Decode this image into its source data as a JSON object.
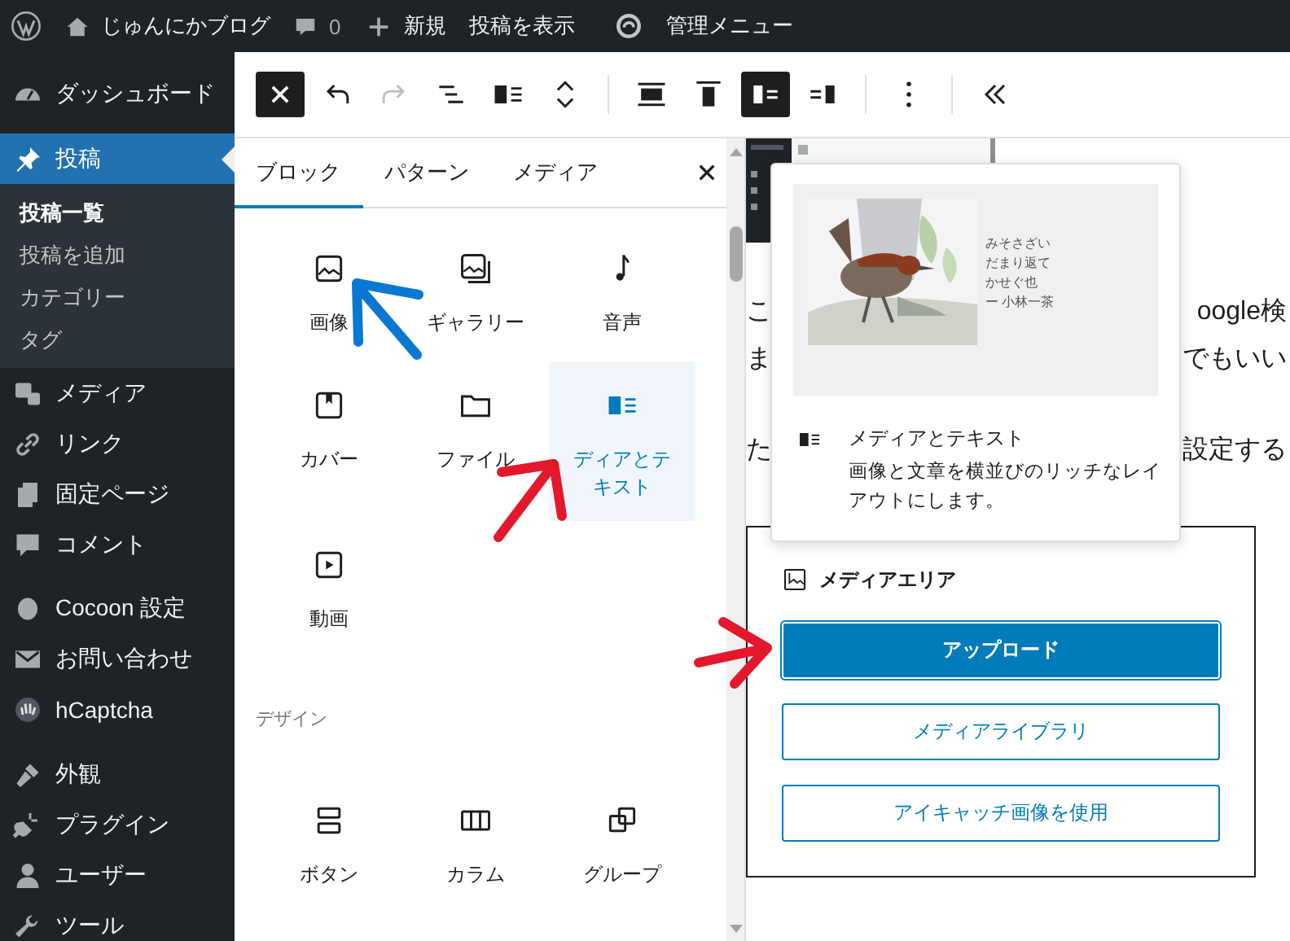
{
  "admin_bar": {
    "items": [
      {
        "kind": "logo"
      },
      {
        "kind": "site",
        "label": "じゅんにかブログ"
      },
      {
        "kind": "comments",
        "label": "0"
      },
      {
        "kind": "new",
        "label": "新規"
      },
      {
        "kind": "link",
        "label": "投稿を表示"
      },
      {
        "kind": "cocoon"
      },
      {
        "kind": "link",
        "label": "管理メニュー"
      }
    ]
  },
  "sidebar": {
    "groups": [
      {
        "items": [
          {
            "label": "ダッシュボード",
            "selected": false
          }
        ]
      },
      {
        "items": [
          {
            "label": "投稿",
            "selected": true,
            "children": [
              {
                "label": "投稿一覧",
                "selected": true
              },
              {
                "label": "投稿を追加",
                "selected": false
              },
              {
                "label": "カテゴリー",
                "selected": false
              },
              {
                "label": "タグ",
                "selected": false
              }
            ]
          },
          {
            "label": "メディア",
            "selected": false
          },
          {
            "label": "リンク",
            "selected": false
          },
          {
            "label": "固定ページ",
            "selected": false
          },
          {
            "label": "コメント",
            "selected": false
          }
        ]
      },
      {
        "items": [
          {
            "label": "Cocoon 設定",
            "selected": false
          },
          {
            "label": "お問い合わせ",
            "selected": false
          },
          {
            "label": "hCaptcha",
            "selected": false
          }
        ]
      },
      {
        "items": [
          {
            "label": "外観",
            "selected": false
          },
          {
            "label": "プラグイン",
            "selected": false
          },
          {
            "label": "ユーザー",
            "selected": false
          },
          {
            "label": "ツール",
            "selected": false
          }
        ]
      }
    ]
  },
  "toolbar": {
    "items": [
      {
        "kind": "button",
        "pressed": true,
        "disabled": false
      },
      {
        "kind": "button",
        "pressed": false,
        "disabled": false
      },
      {
        "kind": "button",
        "pressed": false,
        "disabled": true
      },
      {
        "kind": "button",
        "pressed": false,
        "disabled": false
      },
      {
        "kind": "button",
        "pressed": false,
        "disabled": false
      },
      {
        "kind": "button",
        "pressed": false,
        "disabled": false
      },
      {
        "kind": "separator"
      },
      {
        "kind": "button",
        "pressed": false,
        "disabled": false
      },
      {
        "kind": "button",
        "pressed": false,
        "disabled": false
      },
      {
        "kind": "button",
        "pressed": true,
        "disabled": false
      },
      {
        "kind": "button",
        "pressed": false,
        "disabled": false
      },
      {
        "kind": "separator"
      },
      {
        "kind": "button",
        "pressed": false,
        "disabled": false
      },
      {
        "kind": "separator"
      },
      {
        "kind": "button",
        "pressed": false,
        "disabled": false
      }
    ]
  },
  "inserter": {
    "tabs": [
      {
        "label": "ブロック",
        "selected": true
      },
      {
        "label": "パターン",
        "selected": false
      },
      {
        "label": "メディア",
        "selected": false
      }
    ],
    "sections": [
      {
        "items": [
          {
            "label": "画像",
            "selected": false
          },
          {
            "label": "ギャラリー",
            "selected": false
          },
          {
            "label": "音声",
            "selected": false
          },
          {
            "label": "カバー",
            "selected": false
          },
          {
            "label": "ファイル",
            "selected": false
          },
          {
            "label": "ディアとテキスト",
            "selected": true
          },
          {
            "label": "動画",
            "selected": false
          }
        ]
      },
      {
        "title": "デザイン",
        "items": [
          {
            "label": "ボタン",
            "selected": false
          },
          {
            "label": "カラム",
            "selected": false
          },
          {
            "label": "グループ",
            "selected": false
          }
        ]
      }
    ]
  },
  "canvas": {
    "paragraphs": [
      {
        "lines": [
          {
            "left": "こ",
            "right": "oogle検"
          },
          {
            "left": "ま",
            "right": "でもいい"
          }
        ]
      },
      {
        "lines": [
          {
            "left": "た",
            "right": "設定する"
          }
        ]
      }
    ],
    "media_text_block": {
      "title": "メディアエリア",
      "buttons": [
        {
          "label": "アップロード",
          "kind": "primary"
        },
        {
          "label": "メディアライブラリ",
          "kind": "secondary"
        },
        {
          "label": "アイキャッチ画像を使用",
          "kind": "secondary"
        }
      ]
    }
  },
  "popover": {
    "preview_lines": [
      "みそさざい",
      "だまり返て",
      "かせぐ也",
      "ー 小林一茶"
    ],
    "title": "メディアとテキスト",
    "description": "画像と文章を横並びのリッチなレイアウトにします。"
  },
  "annotations": [
    {
      "color": "#0a78d2"
    },
    {
      "color": "#e3182d"
    },
    {
      "color": "#e3182d"
    }
  ]
}
